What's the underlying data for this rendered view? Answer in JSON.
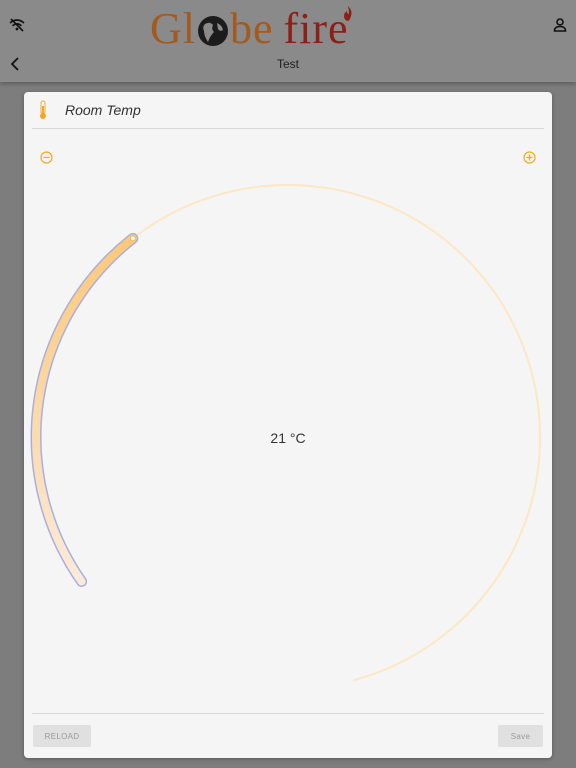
{
  "header": {
    "logo_globe": "Gl",
    "logo_globe_end": "be",
    "logo_fire": "fire",
    "title": "Test",
    "icons": [
      "wifi-off-icon",
      "user-icon",
      "back-chevron-icon"
    ]
  },
  "card": {
    "title": "Room Temp",
    "icon": "thermometer-icon",
    "temperature_display": "21 °C",
    "setpoint_fraction": 0.3,
    "decrease_icon": "minus-circle-icon",
    "increase_icon": "plus-circle-icon"
  },
  "footer": {
    "reload_label": "RELOAD",
    "save_label": "Save"
  },
  "colors": {
    "accent": "#f5a623",
    "arc_fill_start": "#fbeadb",
    "arc_fill_end": "#fbc879",
    "track": "#fde7c4",
    "logo_brown": "#a25a1e",
    "logo_red": "#8c1f16"
  }
}
